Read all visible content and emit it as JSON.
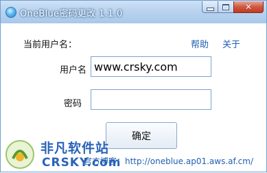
{
  "window": {
    "title": "OneBlue密码更改 1.1.0",
    "icon": "oneblue-app-icon",
    "controls": {
      "close_glyph": "✕"
    }
  },
  "form": {
    "current_user_label": "当前用户名：",
    "current_user_value": "",
    "help_link": "帮助",
    "about_link": "关于",
    "username_label": "用户名",
    "username_value": "www.crsky.com",
    "password_label": "密码",
    "password_value": "",
    "ok_button": "确定"
  },
  "footer": {
    "blog_text": "官方博客：http://oneblue.ap01.aws.af.cm/"
  },
  "watermark": {
    "line1": "非凡软件站",
    "line2": "CRSKY.com"
  },
  "colors": {
    "link": "#1f5fb4",
    "titlebar": "#b9d3ef",
    "close_button": "#c23a22"
  }
}
